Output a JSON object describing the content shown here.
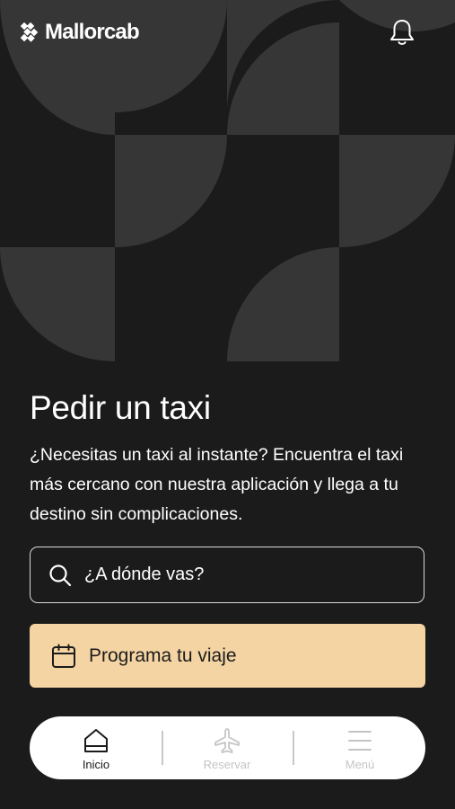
{
  "header": {
    "logo_text": "Mallorcab",
    "notifications_icon": "bell-icon"
  },
  "hero": {
    "title": "Pedir un taxi",
    "description": "¿Necesitas un taxi al instante? Encuentra el taxi más cercano con nuestra aplicación y llega a tu destino sin complicaciones."
  },
  "search": {
    "placeholder": "¿A dónde vas?",
    "value": "",
    "icon": "search-icon"
  },
  "schedule_button": {
    "label": "Programa tu viaje",
    "icon": "calendar-icon"
  },
  "bottom_nav": {
    "items": [
      {
        "label": "Inicio",
        "icon": "home-icon",
        "active": true
      },
      {
        "label": "Reservar",
        "icon": "airplane-icon",
        "active": false
      },
      {
        "label": "Menú",
        "icon": "menu-icon",
        "active": false
      }
    ]
  },
  "colors": {
    "background": "#1b1b1b",
    "pattern": "#363636",
    "accent": "#f5d4a3",
    "nav_background": "#ffffff",
    "nav_inactive": "#c4c4c4"
  }
}
